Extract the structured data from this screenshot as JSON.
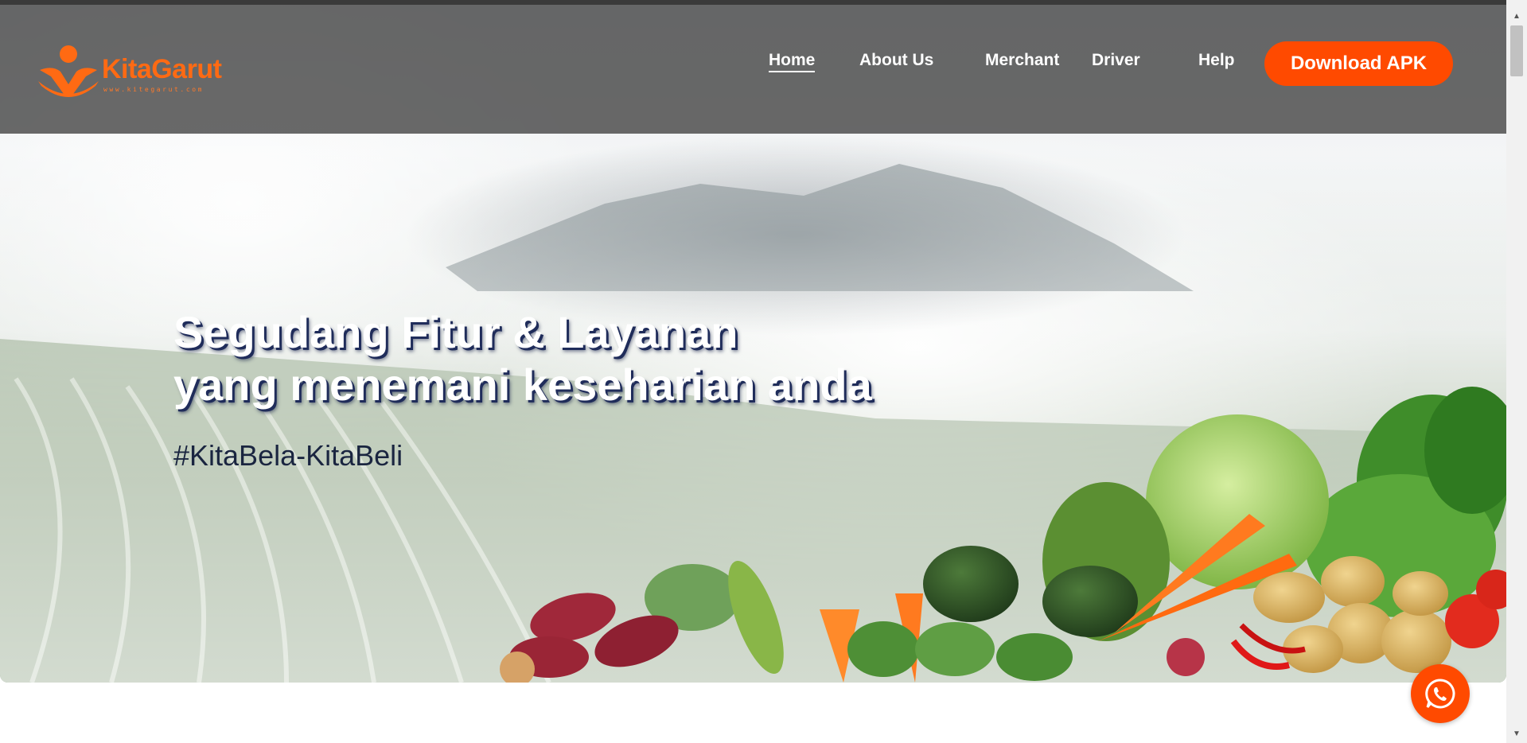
{
  "brand": {
    "name": "KitaGarut",
    "website": "www.kitegarut.com",
    "accent": "#ff4a00"
  },
  "nav": {
    "items": [
      {
        "label": "Home",
        "active": true
      },
      {
        "label": "About Us",
        "active": false
      },
      {
        "label": "Merchant",
        "active": false
      },
      {
        "label": "Driver",
        "active": false
      },
      {
        "label": "Help",
        "active": false
      }
    ],
    "download_label": "Download APK"
  },
  "hero": {
    "title_line1": "Segudang Fitur & Layanan",
    "title_line2": "yang menemani keseharian anda",
    "hashtag": "#KitaBela-KitaBeli"
  },
  "floating": {
    "whatsapp_icon": "whatsapp-icon"
  },
  "colors": {
    "navbar": "#484848",
    "accent": "#ff4a00",
    "title_shadow": "#1f2c5a",
    "hashtag": "#1a2540"
  }
}
